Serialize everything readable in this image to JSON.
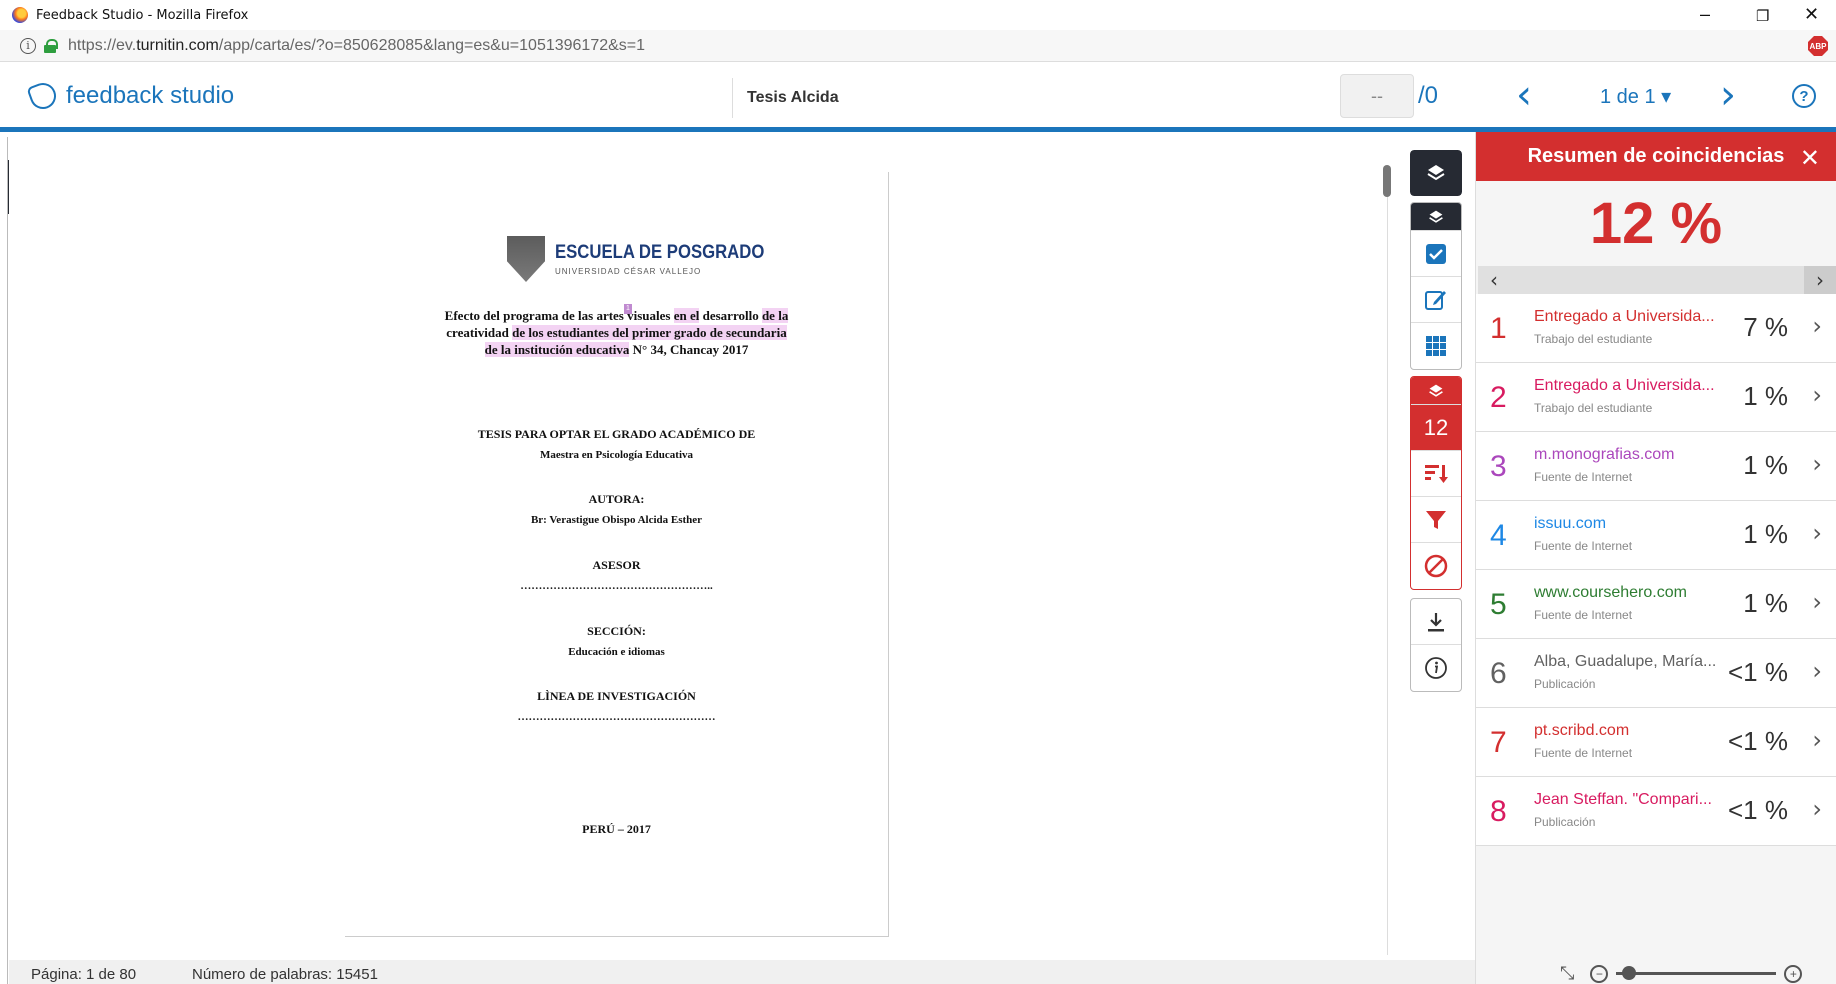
{
  "window": {
    "title": "Feedback Studio - Mozilla Firefox",
    "minimize": "–",
    "restore": "❐",
    "close": "✕",
    "url_prefix": "https://ev.",
    "url_domain": "turnitin.com",
    "url_path": "/app/carta/es/?o=850628085&lang=es&u=1051396172&s=1",
    "info_glyph": "i",
    "abp": "ABP"
  },
  "header": {
    "logo": "feedback studio",
    "doc_title": "Tesis Alcida",
    "grade": "--",
    "grade_max": "/0",
    "prev": "‹",
    "next": "›",
    "page_selector": "1 de 1 ▾",
    "help": "?"
  },
  "document": {
    "crest_title": "ESCUELA DE POSGRADO",
    "crest_subtitle": "UNIVERSIDAD CÉSAR VALLEJO",
    "marker": "1",
    "title_l1_a": "Efecto del programa de las artes visuales ",
    "title_l1_b": "en el",
    "title_l1_c": " desarrollo ",
    "title_l1_d": "de la",
    "title_l2_a": "creatividad ",
    "title_l2_b": "de los estudiantes del primer grado de secundaria",
    "title_l3_a": "de la institución educativa",
    "title_l3_b": " N° 34, Chancay 2017",
    "thesis": "TESIS PARA OPTAR EL GRADO ACADÉMICO DE",
    "degree": "Maestra en Psicología Educativa",
    "author_label": "AUTORA:",
    "author": "Br: Verastigue Obispo Alcida Esther",
    "advisor_label": "ASESOR",
    "dots1": "……………………………………………..",
    "section_label": "SECCIÓN:",
    "section": "Educación e idiomas",
    "line_label": "LÌNEA DE INVESTIGACIÓN",
    "dots2": "………………………………………………",
    "place": "PERÚ – 2017"
  },
  "tools": {
    "match_count": "12"
  },
  "panel": {
    "title": "Resumen de coincidencias",
    "close": "✕",
    "total": "12 %",
    "pager_left": "‹",
    "pager_right": "›",
    "matches": [
      {
        "num": "1",
        "source": "Entregado a Universida...",
        "type": "Trabajo del estudiante",
        "pct": "7 %",
        "color": "#d32f2f"
      },
      {
        "num": "2",
        "source": "Entregado a Universida...",
        "type": "Trabajo del estudiante",
        "pct": "1 %",
        "color": "#d81b60"
      },
      {
        "num": "3",
        "source": "m.monografias.com",
        "type": "Fuente de Internet",
        "pct": "1 %",
        "color": "#ab47bc"
      },
      {
        "num": "4",
        "source": "issuu.com",
        "type": "Fuente de Internet",
        "pct": "1 %",
        "color": "#1e88e5"
      },
      {
        "num": "5",
        "source": "www.coursehero.com",
        "type": "Fuente de Internet",
        "pct": "1 %",
        "color": "#2e7d32"
      },
      {
        "num": "6",
        "source": "Alba, Guadalupe, María...",
        "type": "Publicación",
        "pct": "<1 %",
        "color": "#616161"
      },
      {
        "num": "7",
        "source": "pt.scribd.com",
        "type": "Fuente de Internet",
        "pct": "<1 %",
        "color": "#d32f2f"
      },
      {
        "num": "8",
        "source": "Jean Steffan. \"Compari...",
        "type": "Publicación",
        "pct": "<1 %",
        "color": "#d81b60"
      }
    ],
    "chevron": "›"
  },
  "status": {
    "page": "Página: 1 de 80",
    "words": "Número de palabras: 15451",
    "zoom_out": "−",
    "zoom_in": "+"
  }
}
